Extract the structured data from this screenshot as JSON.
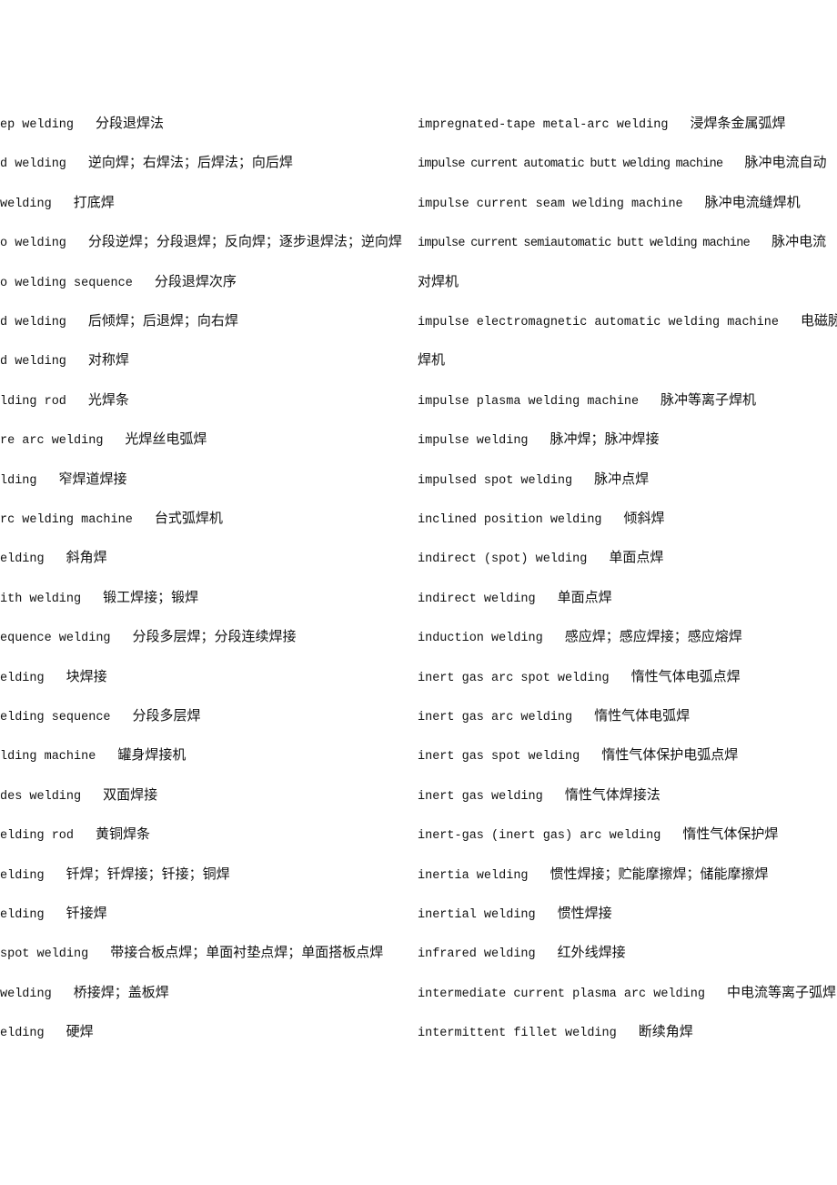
{
  "left_column": [
    {
      "en": "ep welding",
      "zh": "分段退焊法"
    },
    {
      "en": "d welding",
      "zh": "逆向焊；右焊法；后焊法；向后焊"
    },
    {
      "en": " welding",
      "zh": "打底焊"
    },
    {
      "en": "o welding",
      "zh": "分段逆焊；分段退焊；反向焊；逐步退焊法；逆向焊"
    },
    {
      "en": "o welding sequence",
      "zh": "分段退焊次序"
    },
    {
      "en": "d welding",
      "zh": "后倾焊；后退焊；向右焊"
    },
    {
      "en": "d welding",
      "zh": "对称焊"
    },
    {
      "en": "lding rod",
      "zh": "光焊条"
    },
    {
      "en": "re arc welding",
      "zh": "光焊丝电弧焊"
    },
    {
      "en": "lding",
      "zh": "窄焊道焊接"
    },
    {
      "en": "rc welding machine",
      "zh": "台式弧焊机"
    },
    {
      "en": "elding",
      "zh": "斜角焊"
    },
    {
      "en": "ith welding",
      "zh": "锻工焊接；锻焊"
    },
    {
      "en": "equence welding",
      "zh": "分段多层焊；分段连续焊接"
    },
    {
      "en": "elding",
      "zh": "块焊接"
    },
    {
      "en": "elding sequence",
      "zh": "分段多层焊"
    },
    {
      "en": "lding machine",
      "zh": "罐身焊接机"
    },
    {
      "en": "des welding",
      "zh": "双面焊接"
    },
    {
      "en": "elding rod",
      "zh": "黄铜焊条"
    },
    {
      "en": "elding",
      "zh": "钎焊；钎焊接；钎接；铜焊"
    },
    {
      "en": "elding",
      "zh": "钎接焊"
    },
    {
      "en": "spot welding",
      "zh": "带接合板点焊；单面衬垫点焊；单面搭板点焊"
    },
    {
      "en": "welding",
      "zh": "桥接焊；盖板焊"
    },
    {
      "en": "elding",
      "zh": "硬焊"
    }
  ],
  "right_column": [
    {
      "en": "impregnated-tape metal-arc welding",
      "zh": "浸焊条金属弧焊"
    },
    {
      "en": "impulse current automatic butt welding machine",
      "zh": "脉冲电流自动"
    },
    {
      "en": "impulse current seam welding machine",
      "zh": "脉冲电流缝焊机"
    },
    {
      "en": "impulse current semiautomatic butt welding machine",
      "zh": "脉冲电流"
    },
    {
      "en": "",
      "zh": "对焊机"
    },
    {
      "en": "impulse electromagnetic automatic welding machine",
      "zh": "电磁脉"
    },
    {
      "en": "",
      "zh": "焊机"
    },
    {
      "en": "impulse plasma welding machine",
      "zh": "脉冲等离子焊机"
    },
    {
      "en": "impulse welding",
      "zh": "脉冲焊；脉冲焊接"
    },
    {
      "en": "impulsed spot welding",
      "zh": "脉冲点焊"
    },
    {
      "en": "inclined position welding",
      "zh": "倾斜焊"
    },
    {
      "en": "indirect (spot) welding",
      "zh": "单面点焊"
    },
    {
      "en": "indirect welding",
      "zh": "单面点焊"
    },
    {
      "en": "induction welding",
      "zh": "感应焊；感应焊接；感应熔焊"
    },
    {
      "en": "inert gas arc spot welding",
      "zh": "惰性气体电弧点焊"
    },
    {
      "en": "inert gas arc welding",
      "zh": "惰性气体电弧焊"
    },
    {
      "en": "inert gas spot welding",
      "zh": "惰性气体保护电弧点焊"
    },
    {
      "en": "inert gas welding",
      "zh": "惰性气体焊接法"
    },
    {
      "en": "inert-gas (inert gas) arc welding",
      "zh": "惰性气体保护焊"
    },
    {
      "en": "inertia welding",
      "zh": "惯性焊接；贮能摩擦焊；储能摩擦焊"
    },
    {
      "en": "inertial welding",
      "zh": "惯性焊接"
    },
    {
      "en": "infrared welding",
      "zh": "红外线焊接"
    },
    {
      "en": "intermediate current plasma arc welding",
      "zh": "中电流等离子弧焊"
    },
    {
      "en": "intermittent fillet welding",
      "zh": "断续角焊"
    }
  ]
}
